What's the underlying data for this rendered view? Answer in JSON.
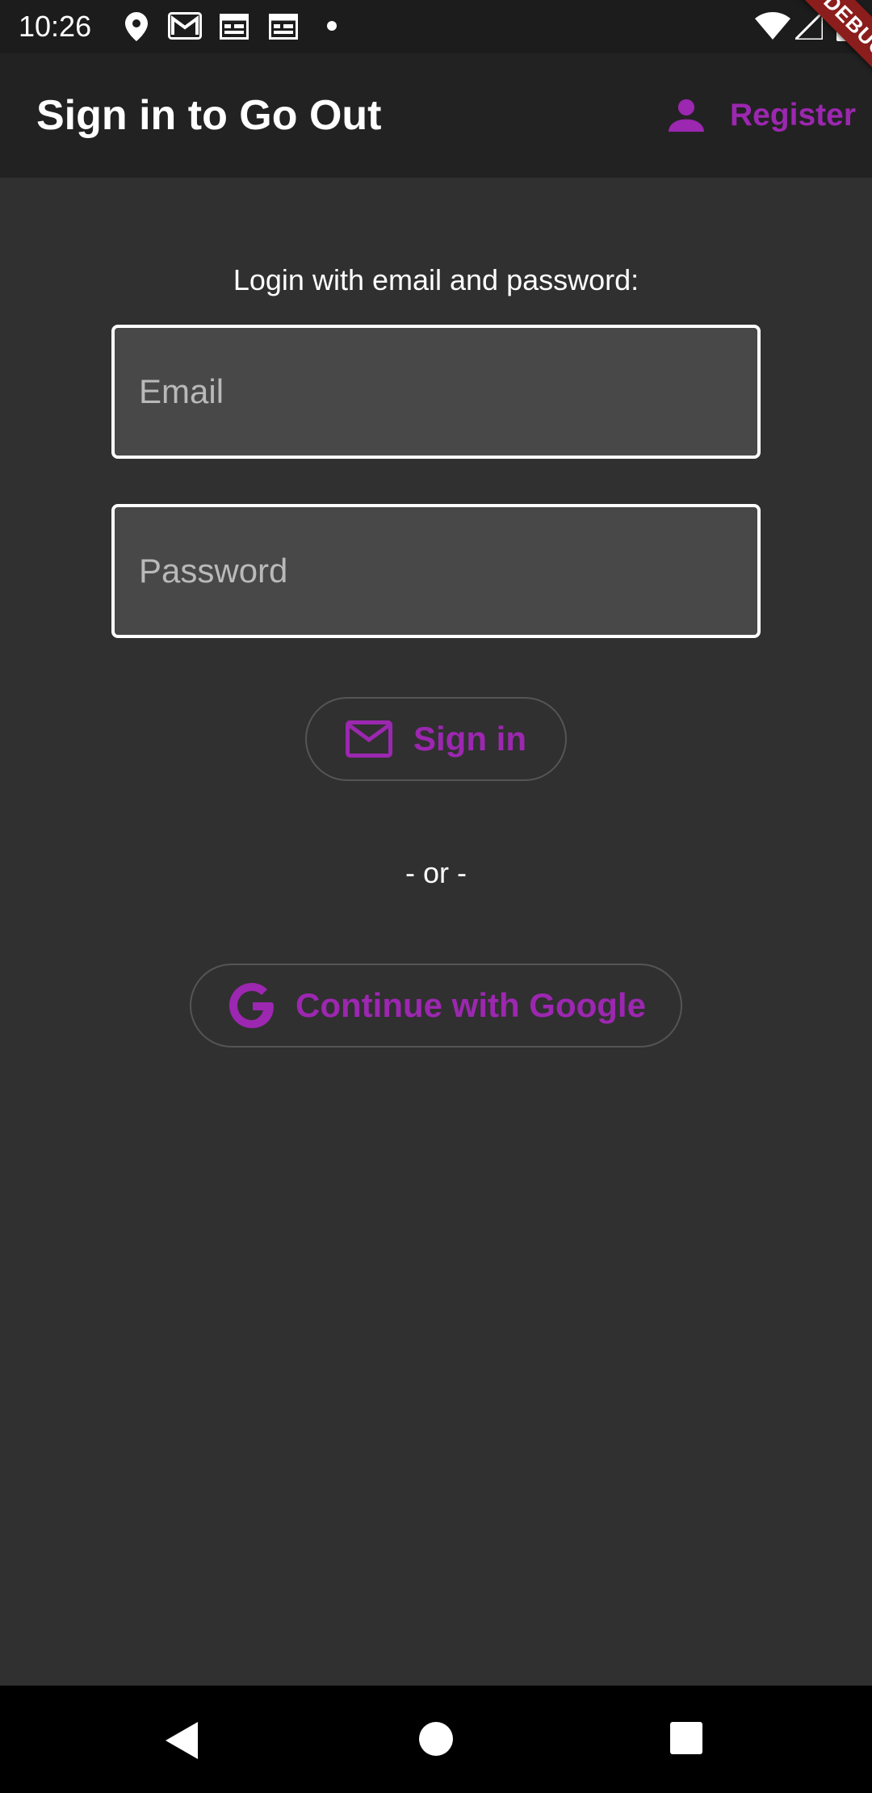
{
  "status_bar": {
    "time": "10:26",
    "left_icons": [
      "location-icon",
      "gmail-icon",
      "calendar-icon",
      "calendar-icon",
      "dot-icon"
    ],
    "right_icons": [
      "wifi-icon",
      "signal-icon",
      "battery-icon"
    ]
  },
  "debug_banner": "DEBUG",
  "app_bar": {
    "title": "Sign in to Go Out",
    "register_label": "Register",
    "register_icon": "person-icon"
  },
  "login": {
    "prompt": "Login with email and password:",
    "email_placeholder": "Email",
    "password_placeholder": "Password",
    "sign_in_label": "Sign in",
    "sign_in_icon": "mail-icon",
    "or_text": "- or -",
    "google_label": "Continue with Google",
    "google_icon": "google-icon"
  },
  "nav_bar": {
    "buttons": [
      "back-icon",
      "home-icon",
      "recents-icon"
    ]
  },
  "colors": {
    "accent": "#9c27b0",
    "background": "#303030",
    "app_bar": "#222222",
    "field_fill": "#484848",
    "debug": "#8b1d1d"
  }
}
